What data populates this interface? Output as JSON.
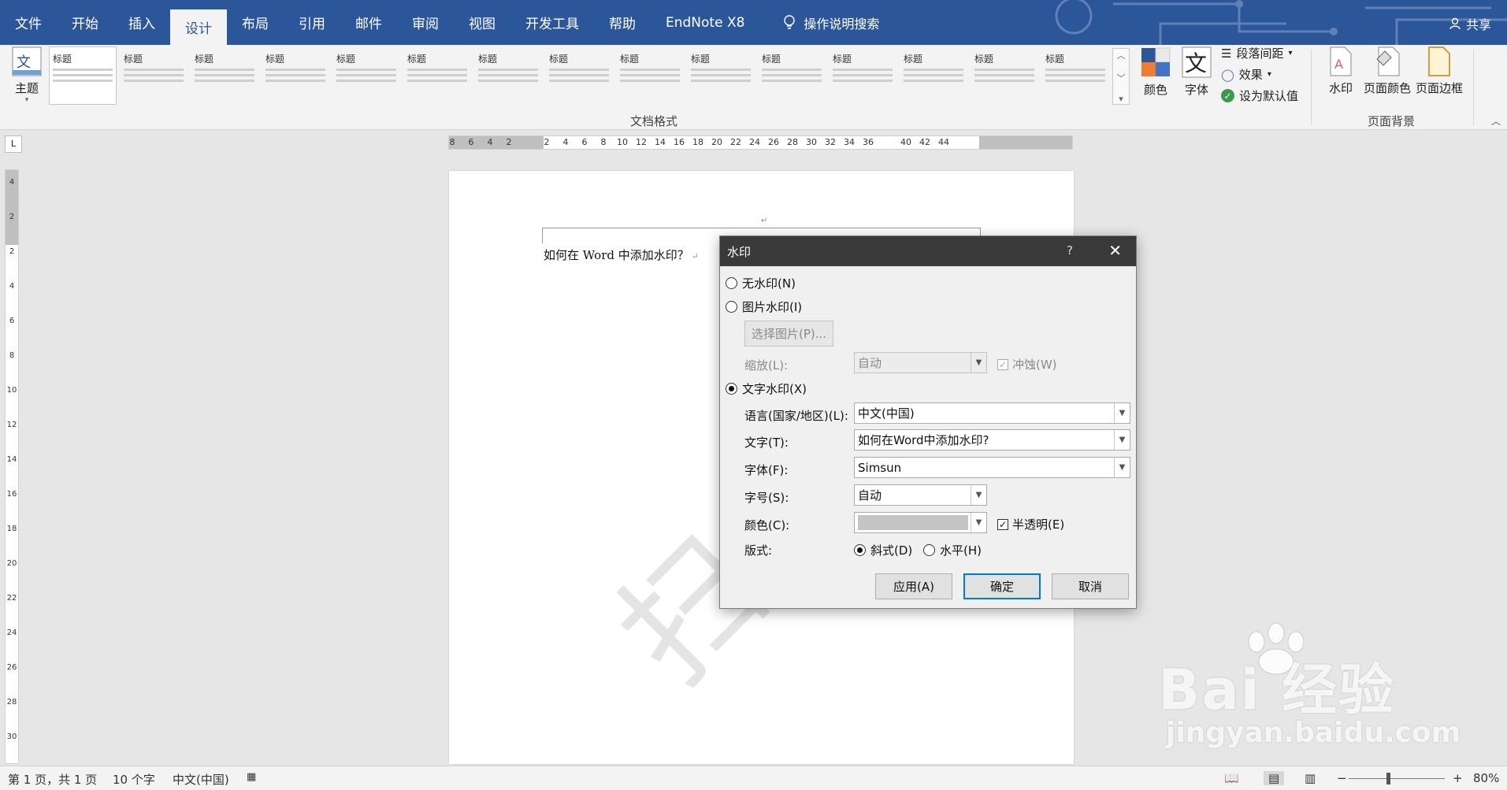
{
  "tabs": [
    "文件",
    "开始",
    "插入",
    "设计",
    "布局",
    "引用",
    "邮件",
    "审阅",
    "视图",
    "开发工具",
    "帮助",
    "EndNote X8"
  ],
  "active_tab": "设计",
  "tell_me": "操作说明搜索",
  "share": "共享",
  "ribbon": {
    "theme_label": "主题",
    "gallery_heading": "标题",
    "document_format_label": "文档格式",
    "colors_label": "颜色",
    "fonts_label": "字体",
    "paragraph_spacing_label": "段落间距",
    "effects_label": "效果",
    "set_default_label": "设为默认值",
    "watermark_label": "水印",
    "page_color_label": "页面颜色",
    "page_border_label": "页面边框",
    "page_background_label": "页面背景"
  },
  "ruler": {
    "h_numbers": [
      "8",
      "6",
      "4",
      "2",
      "2",
      "4",
      "6",
      "8",
      "10",
      "12",
      "14",
      "16",
      "18",
      "20",
      "22",
      "24",
      "26",
      "28",
      "30",
      "32",
      "34",
      "36",
      "40",
      "42",
      "44"
    ],
    "v_numbers": [
      "4",
      "2",
      "2",
      "4",
      "6",
      "8",
      "10",
      "12",
      "14",
      "16",
      "18",
      "20",
      "22",
      "24",
      "26",
      "28",
      "30"
    ]
  },
  "document": {
    "text": "如何在 Word 中添加水印？",
    "watermark_text": "扫儿"
  },
  "dialog": {
    "title": "水印",
    "help": "?",
    "no_watermark": "无水印(N)",
    "picture_watermark": "图片水印(I)",
    "select_picture": "选择图片(P)...",
    "scale_label": "缩放(L):",
    "scale_value": "自动",
    "washout_label": "冲蚀(W)",
    "text_watermark": "文字水印(X)",
    "language_label": "语言(国家/地区)(L):",
    "language_value": "中文(中国)",
    "text_label": "文字(T):",
    "text_value": "如何在Word中添加水印?",
    "font_label": "字体(F):",
    "font_value": "Simsun",
    "size_label": "字号(S):",
    "size_value": "自动",
    "color_label": "颜色(C):",
    "color_value": "#c4c4c4",
    "semitransparent_label": "半透明(E)",
    "layout_label": "版式:",
    "diagonal_label": "斜式(D)",
    "horizontal_label": "水平(H)",
    "apply_button": "应用(A)",
    "ok_button": "确定",
    "cancel_button": "取消"
  },
  "status": {
    "page": "第 1 页，共 1 页",
    "words": "10 个字",
    "language": "中文(中国)",
    "zoom": "80%"
  },
  "overlay": {
    "brand": "Bai  经验",
    "url": "jingyan.baidu.com"
  },
  "colors": {
    "accent": "#2b579a",
    "ribbon_bg": "#f3f3f3",
    "dialog_title_bg": "#3a3a3a"
  }
}
